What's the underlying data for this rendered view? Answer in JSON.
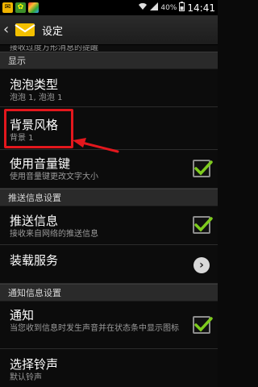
{
  "status_bar": {
    "battery": "40%",
    "time": "14:41"
  },
  "action_bar": {
    "title": "设定"
  },
  "partial_row": {
    "text": "接收过度方形消息的提醒"
  },
  "sections": {
    "display": "显示",
    "push": "推送信息设置",
    "notify": "通知信息设置"
  },
  "rows": {
    "bubble_type": {
      "title": "泡泡类型",
      "summary": "泡泡 1, 泡泡 1"
    },
    "background_style": {
      "title": "背景风格",
      "summary": "背景 1"
    },
    "volume_key": {
      "title": "使用音量键",
      "summary": "使用音量键更改文字大小",
      "checked": true
    },
    "push_message": {
      "title": "推送信息",
      "summary": "接收来自网络的推送信息",
      "checked": true
    },
    "loader_service": {
      "title": "装载服务"
    },
    "notification": {
      "title": "通知",
      "summary": "当您收到信息时发生声音并在状态条中显示图标",
      "checked": true
    },
    "ringtone": {
      "title": "选择铃声",
      "summary": "默认铃声"
    }
  },
  "colors": {
    "highlight": "#e3171d",
    "check": "#7ecb1e"
  }
}
